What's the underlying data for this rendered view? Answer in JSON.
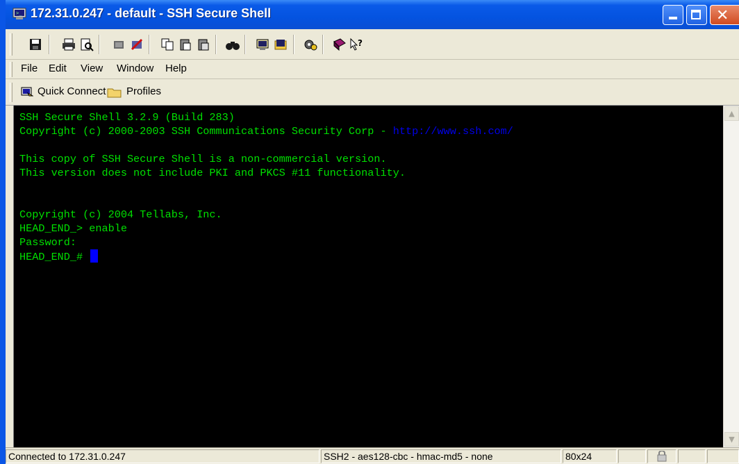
{
  "window": {
    "title": "172.31.0.247 - default - SSH Secure Shell",
    "title_icon": "terminal-app-icon"
  },
  "toolbar": {
    "icons": [
      "save-icon",
      "print-icon",
      "print-preview-icon",
      "disconnect-icon",
      "new-connection-icon",
      "copy-icon",
      "paste-icon",
      "paste-special-icon",
      "find-icon",
      "new-terminal-window-icon",
      "new-file-transfer-icon",
      "settings-icon",
      "help-book-icon",
      "context-help-icon"
    ]
  },
  "menu": {
    "items": [
      "File",
      "Edit",
      "View",
      "Window",
      "Help"
    ]
  },
  "quickbar": {
    "quick_connect": "Quick Connect",
    "profiles": "Profiles"
  },
  "terminal": {
    "line1": "SSH Secure Shell 3.2.9 (Build 283)",
    "line2_text": "Copyright (c) 2000-2003 SSH Communications Security Corp - ",
    "line2_link": "http://www.ssh.com/",
    "line3": "This copy of SSH Secure Shell is a non-commercial version.",
    "line4": "This version does not include PKI and PKCS #11 functionality.",
    "line5": "Copyright (c) 2004 Tellabs, Inc.",
    "line6": "HEAD_END_> enable",
    "line7": "Password:",
    "line8": "HEAD_END_# ",
    "text_color": "#00e000",
    "link_color": "#0000e8",
    "cursor_color": "#0000ff",
    "background": "#000000"
  },
  "status": {
    "connection": "Connected to 172.31.0.247",
    "cipher": "SSH2 - aes128-cbc - hmac-md5 - none",
    "size": "80x24"
  }
}
